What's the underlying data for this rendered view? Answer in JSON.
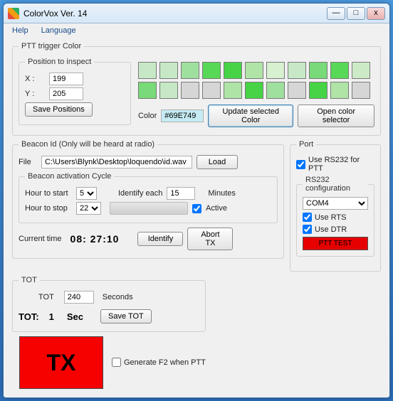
{
  "title": "ColorVox  Ver. 14",
  "menu": {
    "help": "Help",
    "language": "Language"
  },
  "ptt_color": {
    "legend": "PTT trigger Color",
    "pos_legend": "Position to inspect",
    "x_label": "X :",
    "x_value": "199",
    "y_label": "Y :",
    "y_value": "205",
    "save_positions": "Save Positions",
    "color_label": "Color",
    "color_value": "#69E749",
    "update_btn": "Update selected Color",
    "open_sel_btn": "Open color selector",
    "swatches_row1": [
      "#c6e8c6",
      "#c6e8c6",
      "#9fe09f",
      "#57d857",
      "#46d446",
      "#b0e4a7",
      "#d6f0d0",
      "#c6e8c6",
      "#78da78",
      "#57d857",
      "#cdeac7"
    ],
    "swatches_row2": [
      "#78da78",
      "#c6e8c6",
      "#d6d6d6",
      "#d6d6d6",
      "#aee4a6",
      "#46d446",
      "#9fe09f",
      "#d6d6d6",
      "#46d446",
      "#b0e4a7",
      "#d6d6d6"
    ]
  },
  "beacon": {
    "legend": "Beacon  Id (Only will  be heard at radio)",
    "file_label": "File",
    "file_value": "C:\\Users\\Blynk\\Desktop\\loquendo\\id.wav",
    "load_btn": "Load",
    "cycle_legend": "Beacon activation Cycle",
    "hour_start_label": "Hour to start",
    "hour_start_value": "5",
    "hour_stop_label": "Hour to stop",
    "hour_stop_value": "22",
    "identify_each_label": "Identify each",
    "identify_each_value": "15",
    "minutes_label": "Minutes",
    "active_label": "Active",
    "current_time_label": "Current time",
    "current_time_value": "08: 27:10",
    "identify_btn": "Identify",
    "abort_btn": "Abort TX"
  },
  "port": {
    "legend": "Port",
    "use_rs232": "Use RS232 for PTT",
    "rs232_cfg_legend": "RS232 configuration",
    "com_value": "COM4",
    "use_rts": "Use RTS",
    "use_dtr": "Use DTR",
    "ptt_test": "PTT TEST"
  },
  "tot": {
    "legend": "TOT",
    "tot_label": "TOT",
    "tot_value": "240",
    "seconds_label": "Seconds",
    "tot_count_label": "TOT:",
    "tot_count_value": "1",
    "sec_label": "Sec",
    "save_tot": "Save TOT"
  },
  "tx_indicator": "TX",
  "gen_f2": "Generate F2 when PTT"
}
